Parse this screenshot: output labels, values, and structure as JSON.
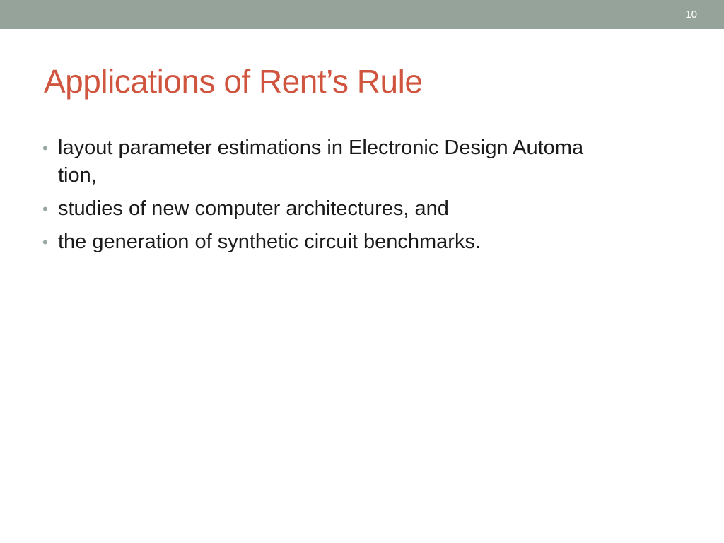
{
  "header": {
    "slide_number": "10"
  },
  "title": "Applications of Rent’s Rule",
  "bullets": [
    {
      "lines": [
        "layout parameter estimations in Electronic Design Automa",
        "tion,"
      ]
    },
    {
      "lines": [
        "studies of new computer architectures, and"
      ]
    },
    {
      "lines": [
        "the generation of synthetic circuit benchmarks."
      ]
    }
  ],
  "bullet_glyph": "•",
  "colors": {
    "header_bar": "#95a39a",
    "title": "#d0553f",
    "bullet": "#9aa9a0",
    "body_text": "#1a1a1a"
  }
}
